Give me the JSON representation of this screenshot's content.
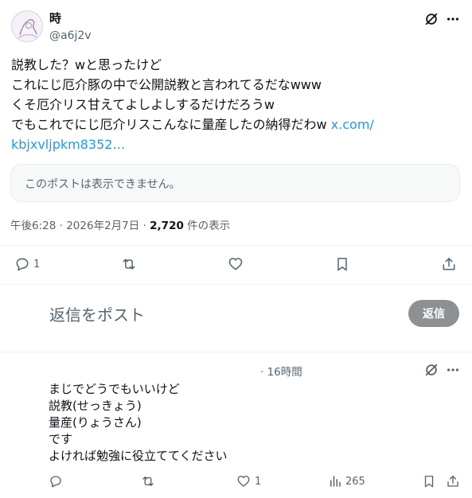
{
  "post": {
    "display_name": "時",
    "handle": "@a6j2v",
    "body_lines": [
      "説教した？wと思ったけど",
      "これにじ厄介豚の中で公開説教と言われてるだなwww",
      "くそ厄介リス甘えてよしよしするだけだろうw"
    ],
    "last_line_text": "でもこれでにじ厄介リスこんなに量産したの納得だわw ",
    "link_part1": "x.com/",
    "link_part2": "kbjxvljpkm8352…",
    "quote_unavailable": "このポストは表示できません。",
    "time": "午後6:28",
    "date": "2026年2月7日",
    "separator": "·",
    "views_count": "2,720",
    "views_label": " 件の表示",
    "reply_count": "1",
    "repost_count": "",
    "like_count": ""
  },
  "composer": {
    "placeholder": "返信をポスト",
    "button_label": "返信"
  },
  "reply": {
    "time": "· 16時間",
    "lines": [
      "まじでどうでもいいけど",
      "説教(せっきょう)",
      "量産(りょうさん)",
      "です",
      "よければ勉強に役立ててください"
    ],
    "like_count": "1",
    "views_count": "265"
  },
  "colors": {
    "accent": "#1d9bf0",
    "muted": "#536471",
    "reply_button": "#8e9193"
  }
}
